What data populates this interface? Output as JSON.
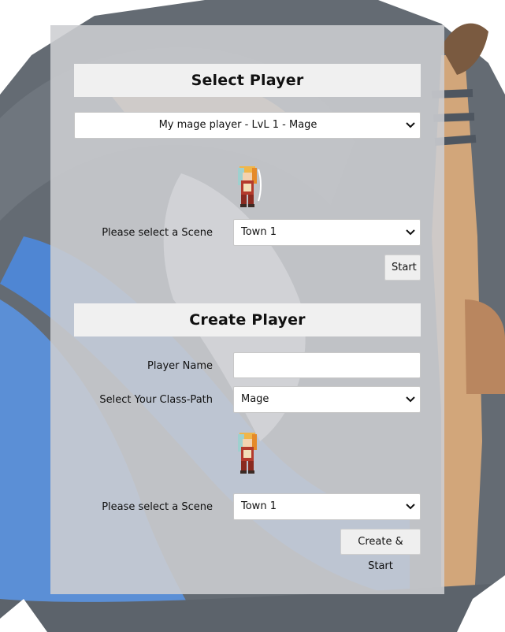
{
  "select_player": {
    "title": "Select Player",
    "player_select": {
      "value": "My mage player - LvL 1 - Mage"
    },
    "scene_label": "Please select a Scene",
    "scene_select": {
      "value": "Town 1"
    },
    "start_label": "Start",
    "sprite_icon": "mage-sprite-icon"
  },
  "create_player": {
    "title": "Create Player",
    "name_label": "Player Name",
    "name_value": "",
    "class_label": "Select Your Class-Path",
    "class_select": {
      "value": "Mage"
    },
    "scene_label": "Please select a Scene",
    "scene_select": {
      "value": "Town 1"
    },
    "submit_label": "Create & Start",
    "sprite_icon": "mage-sprite-icon"
  },
  "colors": {
    "panel": "#cdced2",
    "header_bg": "#f0f0f0",
    "background_dark": "#5f6670",
    "background_blue": "#5b8fd6",
    "background_tan": "#d2a67a"
  }
}
